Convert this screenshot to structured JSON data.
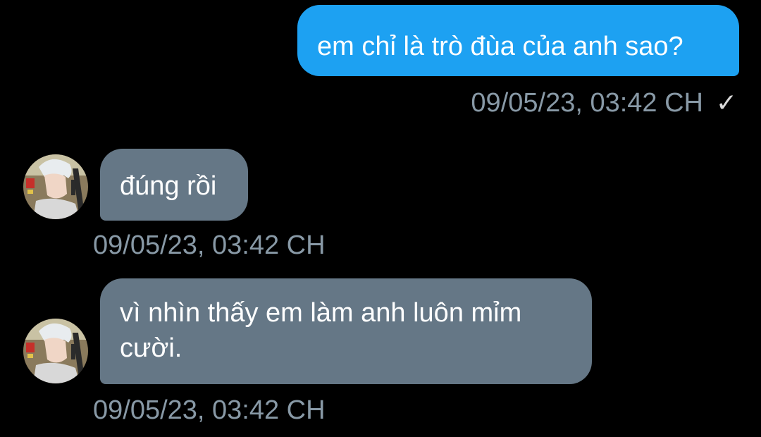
{
  "colors": {
    "background": "#000000",
    "sent_bubble": "#1DA1F2",
    "received_bubble": "#657786",
    "timestamp_text": "#8899A6",
    "message_text": "#FFFFFF"
  },
  "messages": [
    {
      "direction": "sent",
      "text": "em chỉ là trò đùa của anh sao?",
      "timestamp": "09/05/23, 03:42 CH",
      "status_icon": "check-icon",
      "status_glyph": "✓"
    },
    {
      "direction": "received",
      "avatar_icon": "avatar",
      "text": "đúng rồi",
      "timestamp": "09/05/23, 03:42 CH"
    },
    {
      "direction": "received",
      "avatar_icon": "avatar",
      "text": "vì nhìn thấy em làm anh luôn mỉm cười.",
      "timestamp": "09/05/23, 03:42 CH"
    }
  ]
}
